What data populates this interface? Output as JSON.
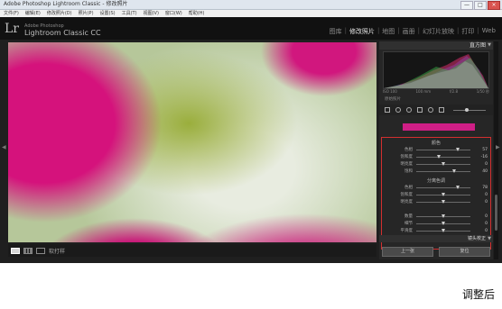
{
  "window": {
    "title": "Adobe Photoshop Lightroom Classic - 修改照片",
    "controls": [
      "—",
      "□",
      "×"
    ]
  },
  "menubar": [
    "文件(F)",
    "编辑(E)",
    "修改照片(D)",
    "照片(P)",
    "设置(S)",
    "工具(T)",
    "视图(V)",
    "窗口(W)",
    "帮助(H)"
  ],
  "identity": {
    "logo": "Lr",
    "brand_line1": "Adobe Photoshop",
    "brand_line2": "Lightroom Classic CC"
  },
  "modules": {
    "items": [
      "图库",
      "修改照片",
      "地图",
      "画册",
      "幻灯片放映",
      "打印",
      "Web"
    ],
    "active": "修改照片"
  },
  "filmstrip": {
    "label": "软打样"
  },
  "panel": {
    "histogram_title": "直方图",
    "histogram_labels": [
      "ISO 100",
      "100 mm",
      "f/2.8",
      "1/50 秒"
    ],
    "original_photo": "原始照片",
    "swatch_color": "#cf1e86",
    "hsl": {
      "title": "颜色",
      "rows": [
        {
          "label": "色相",
          "value": "57",
          "level": 0.78
        },
        {
          "label": "饱和度",
          "value": "-16",
          "level": 0.42
        },
        {
          "label": "明亮度",
          "value": "0",
          "level": 0.5
        },
        {
          "label": "饱和",
          "value": "40",
          "level": 0.7
        }
      ],
      "split_title": "分离色调",
      "split_rows": [
        {
          "label": "色相",
          "value": "78",
          "level": 0.78
        },
        {
          "label": "饱和度",
          "value": "0",
          "level": 0.5
        },
        {
          "label": "明亮度",
          "value": "0",
          "level": 0.5
        }
      ],
      "extra_rows": [
        {
          "label": "数量",
          "value": "0",
          "level": 0.5
        },
        {
          "label": "细节",
          "value": "0",
          "level": 0.5
        },
        {
          "label": "平滑度",
          "value": "0",
          "level": 0.5
        }
      ]
    },
    "lens_title": "镜头校正",
    "buttons": [
      "上一张",
      "复位"
    ]
  },
  "caption": "调整后"
}
